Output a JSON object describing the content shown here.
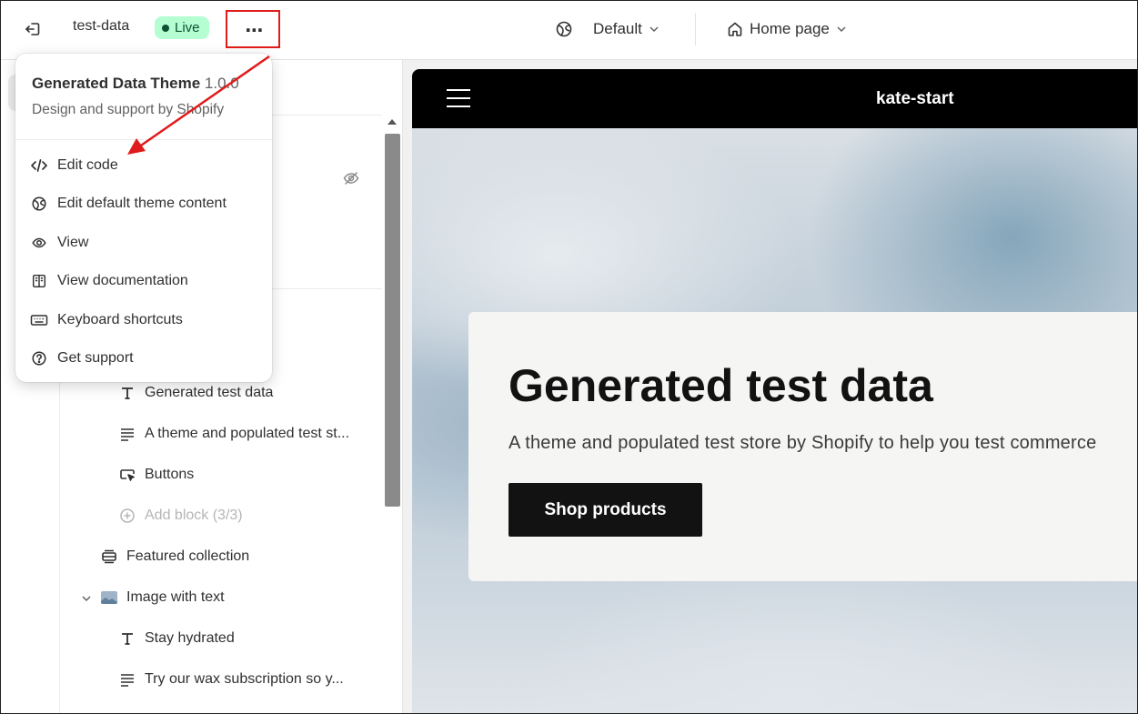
{
  "topbar": {
    "theme_name": "test-data",
    "live_label": "Live",
    "more_label": "⋯",
    "language_selector": "Default",
    "page_selector": "Home page"
  },
  "menu": {
    "title": "Generated Data Theme",
    "version": "1.0.0",
    "subtitle": "Design and support by Shopify",
    "items": [
      {
        "label": "Edit code",
        "icon": "code-icon"
      },
      {
        "label": "Edit default theme content",
        "icon": "globe-icon"
      },
      {
        "label": "View",
        "icon": "eye-icon"
      },
      {
        "label": "View documentation",
        "icon": "book-icon"
      },
      {
        "label": "Keyboard shortcuts",
        "icon": "keyboard-icon"
      },
      {
        "label": "Get support",
        "icon": "question-icon"
      }
    ]
  },
  "sidebar": {
    "items": [
      {
        "label": "Generated test data",
        "icon": "text-icon"
      },
      {
        "label": "A theme and populated test st...",
        "icon": "paragraph-icon"
      },
      {
        "label": "Buttons",
        "icon": "cursor-button-icon"
      },
      {
        "label": "Add block (3/3)",
        "icon": "plus-circle-icon"
      },
      {
        "label": "Featured collection",
        "icon": "collection-icon"
      },
      {
        "label": "Image with text",
        "icon": "image-icon"
      },
      {
        "label": "Stay hydrated",
        "icon": "text-icon"
      },
      {
        "label": "Try our wax subscription so y...",
        "icon": "paragraph-icon"
      }
    ]
  },
  "preview": {
    "store_name": "kate-start",
    "hero_title": "Generated test data",
    "hero_text": "A theme and populated test store by Shopify to help you test commerce",
    "hero_button": "Shop products"
  },
  "colors": {
    "live_badge_bg": "#b4fed2",
    "highlight_red": "#e01b1b",
    "store_header_bg": "#000000",
    "hero_button_bg": "#121212"
  }
}
